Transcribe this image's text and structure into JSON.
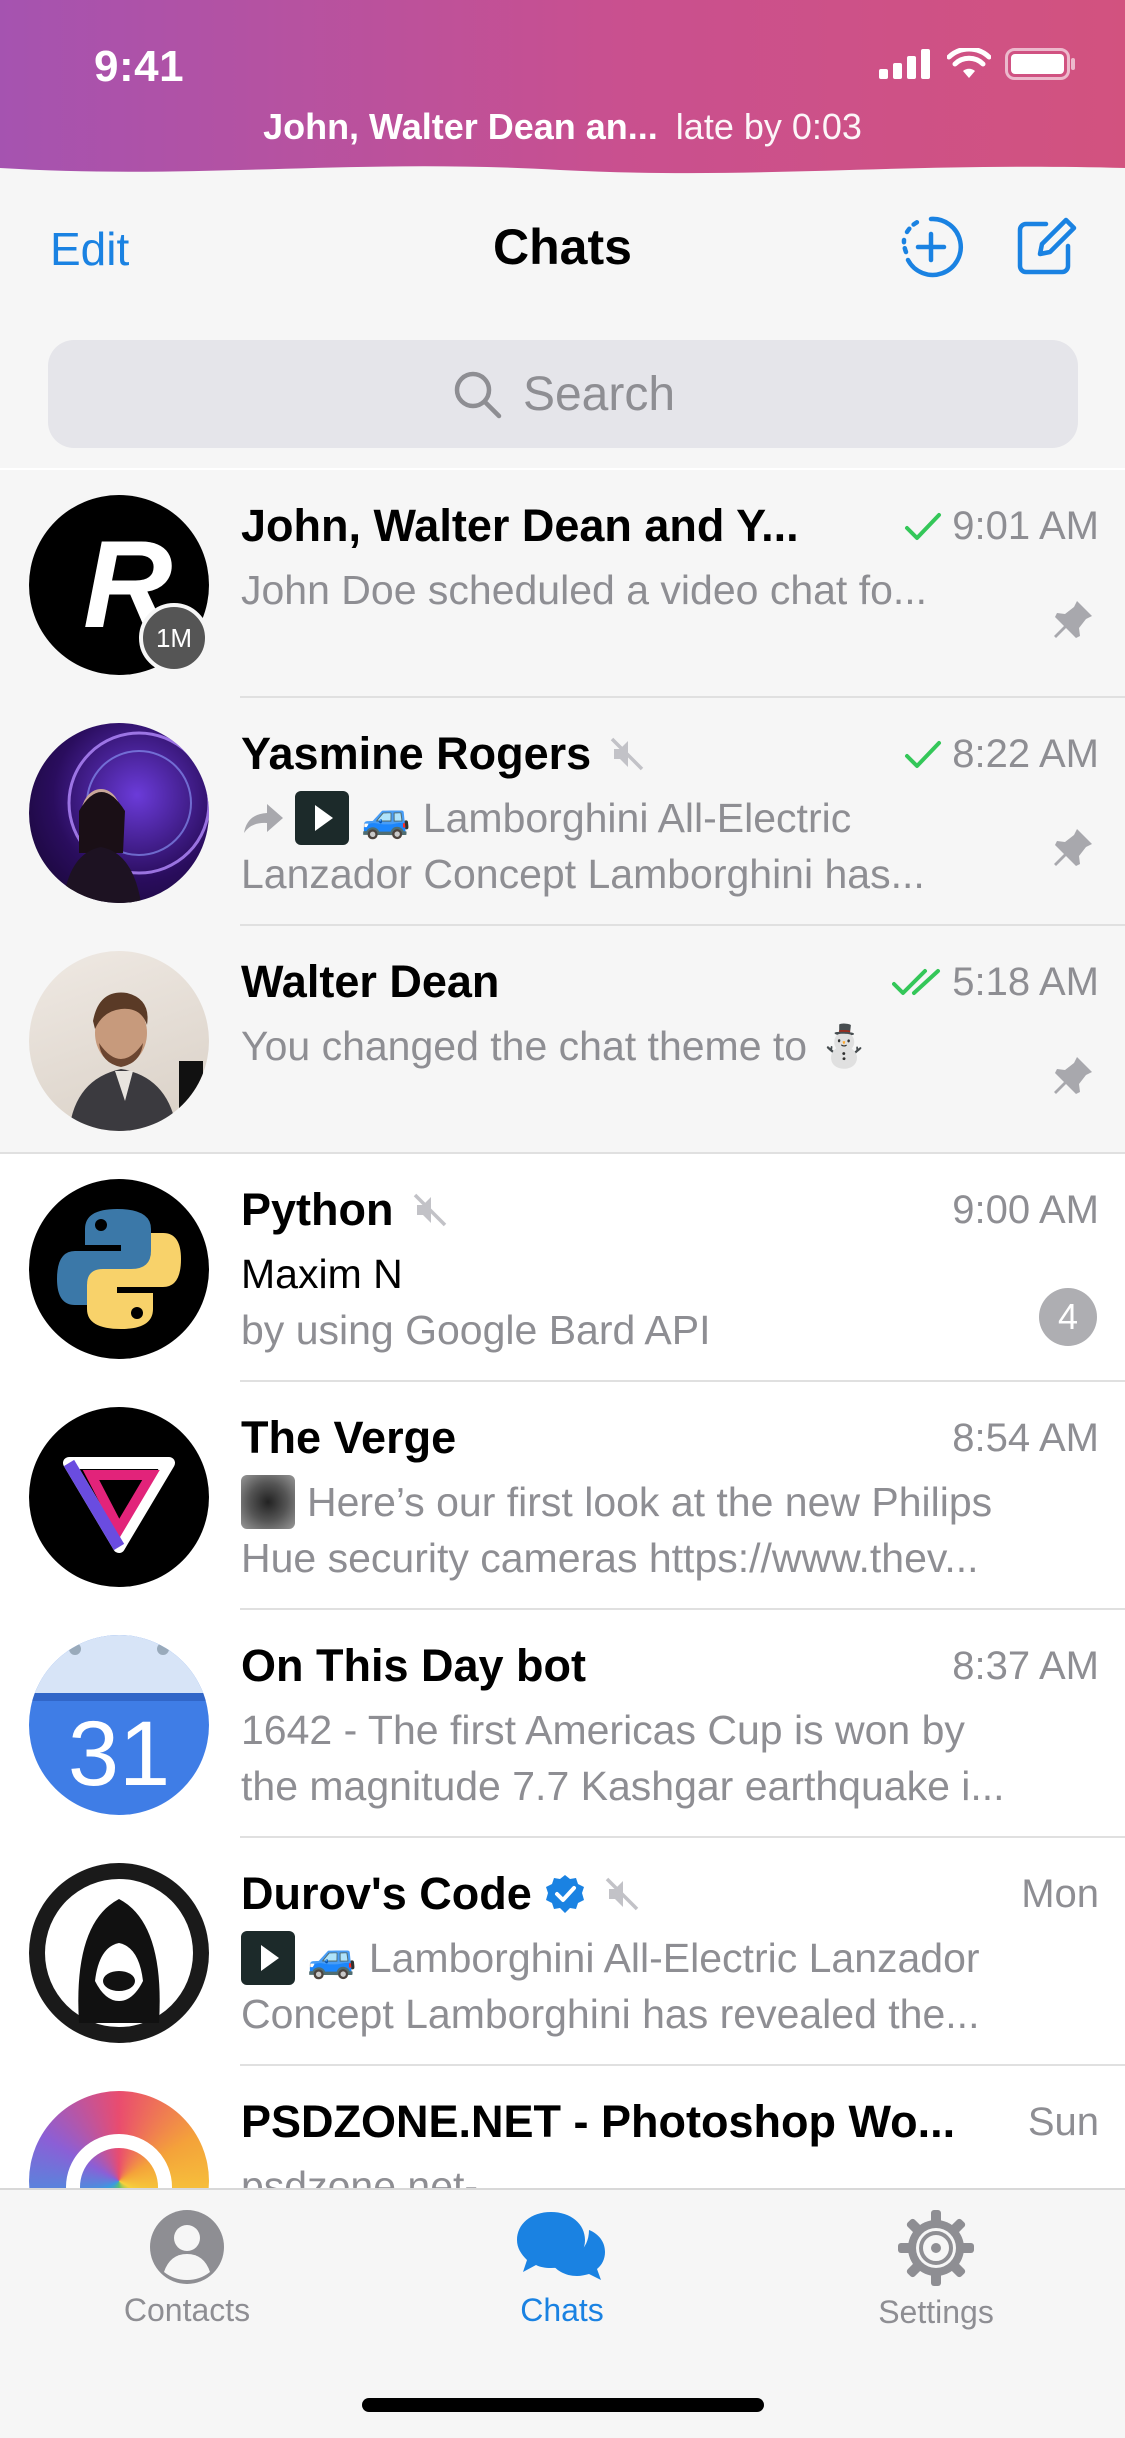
{
  "status_bar": {
    "time": "9:41",
    "call_names": "John, Walter Dean an...",
    "call_status": "late by 0:03"
  },
  "header": {
    "edit_label": "Edit",
    "title": "Chats",
    "search_placeholder": "Search"
  },
  "chats": [
    {
      "name": "John, Walter Dean and Y...",
      "time": "9:01 AM",
      "line1": "John Doe scheduled a video chat fo...",
      "line2": "",
      "status": "read",
      "pinned": true,
      "muted": false,
      "avatar_badge": "1M",
      "avatar_letter": "R"
    },
    {
      "name": "Yasmine Rogers",
      "time": "8:22 AM",
      "line1": "Lamborghini All-Electric",
      "line2": "Lanzador Concept Lamborghini has...",
      "status": "read",
      "pinned": true,
      "muted": true
    },
    {
      "name": "Walter Dean",
      "time": "5:18 AM",
      "line1": "You changed the chat theme to ⛄",
      "line2": "",
      "status": "double-read",
      "pinned": true,
      "muted": false
    },
    {
      "name": "Python",
      "time": "9:00 AM",
      "sender": "Maxim N",
      "line2": "by using Google Bard API",
      "badge": "4",
      "pinned": false,
      "muted": true
    },
    {
      "name": "The Verge",
      "time": "8:54 AM",
      "line1": "Here’s our first look at the new Philips",
      "line2": "Hue security cameras https://www.thev...",
      "pinned": false,
      "muted": false
    },
    {
      "name": "On This Day bot",
      "time": "8:37 AM",
      "line1": "1642 - The first Americas Cup is won by",
      "line2": "the magnitude 7.7 Kashgar earthquake i...",
      "pinned": false,
      "muted": false,
      "avatar_text": "31"
    },
    {
      "name": "Durov's Code",
      "time": "Mon",
      "line1": "Lamborghini All-Electric Lanzador",
      "line2": "Concept Lamborghini has revealed the...",
      "pinned": false,
      "muted": true,
      "verified": true
    },
    {
      "name": "PSDZONE.NET - Photoshop Wo...",
      "time": "Sun",
      "line1": "psdzone.net-",
      "line2": "",
      "pinned": false,
      "muted": false
    }
  ],
  "tabs": [
    {
      "label": "Contacts",
      "active": false
    },
    {
      "label": "Chats",
      "active": true
    },
    {
      "label": "Settings",
      "active": false
    }
  ],
  "colors": {
    "accent": "#1a82e2",
    "read_check": "#34c759",
    "banner_left": "#a553b0",
    "banner_right": "#d2527f"
  }
}
